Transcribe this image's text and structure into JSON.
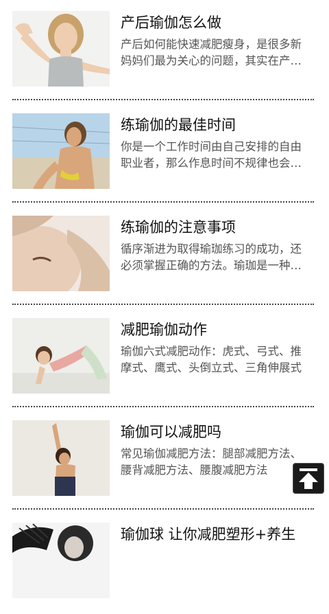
{
  "articles": [
    {
      "title": "产后瑜伽怎么做",
      "summary": "产后如何能快速减肥瘦身，是很多新妈妈们最为关心的问题，其实在产后减肥瘦身",
      "image": "photo-woman-stretching-arms"
    },
    {
      "title": "练瑜伽的最佳时间",
      "summary": "你是一个工作时间由自己安排的自由职业者，那么作息时间不规律也会影响练习",
      "image": "photo-woman-bikini-beach"
    },
    {
      "title": "练瑜伽的注意事项",
      "summary": "循序渐进为取得瑜珈练习的成功，还必须掌握正确的方法。瑜珈是一种科学",
      "image": "photo-woman-face-massage"
    },
    {
      "title": "减肥瑜伽动作",
      "summary": "瑜伽六式减肥动作：虎式、弓式、推摩式、鹰式、头倒立式、三角伸展式",
      "image": "photo-woman-yoga-pose"
    },
    {
      "title": "瑜伽可以减肥吗",
      "summary": "常见瑜伽减肥方法：腿部减肥方法、腰背减肥方法、腰腹减肥方法",
      "image": "photo-woman-arms-raised"
    },
    {
      "title": "瑜伽球 让你减肥塑形+养生",
      "summary": "",
      "image": "photo-woman-feather-portrait"
    }
  ],
  "back_to_top": {
    "icon": "arrow-up-to-top-icon"
  }
}
